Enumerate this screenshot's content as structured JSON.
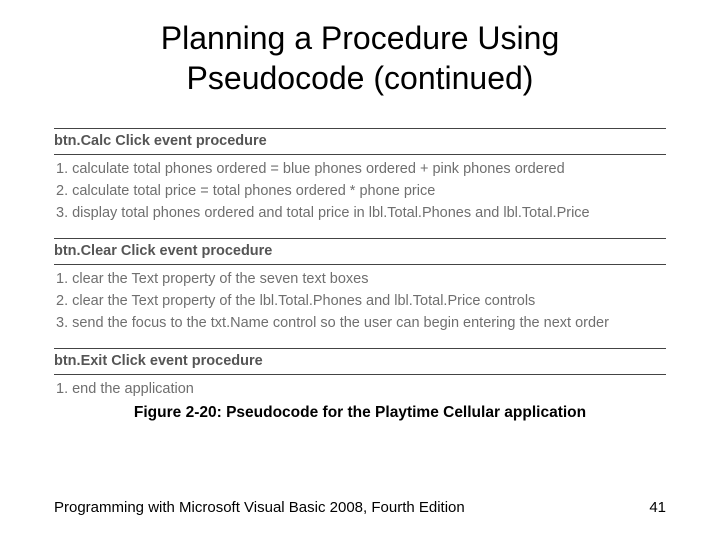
{
  "title_line1": "Planning a Procedure Using",
  "title_line2": "Pseudocode (continued)",
  "procedures": {
    "calc": {
      "header": "btn.Calc Click event procedure",
      "steps": {
        "s1": "1. calculate total phones ordered = blue phones ordered + pink phones ordered",
        "s2": "2. calculate total price = total phones ordered * phone price",
        "s3": "3. display total phones ordered and total price in lbl.Total.Phones and lbl.Total.Price"
      }
    },
    "clear": {
      "header": "btn.Clear Click event procedure",
      "steps": {
        "s1": "1. clear the Text property of the seven text boxes",
        "s2": "2. clear the Text property of the lbl.Total.Phones and lbl.Total.Price controls",
        "s3": "3. send the focus to the txt.Name control so the user can begin entering the next order"
      }
    },
    "exit": {
      "header": "btn.Exit Click event procedure",
      "steps": {
        "s1": "1. end the application"
      }
    }
  },
  "caption": "Figure 2-20: Pseudocode for the Playtime Cellular application",
  "footer": {
    "text": "Programming with Microsoft Visual Basic 2008, Fourth Edition",
    "page": "41"
  }
}
